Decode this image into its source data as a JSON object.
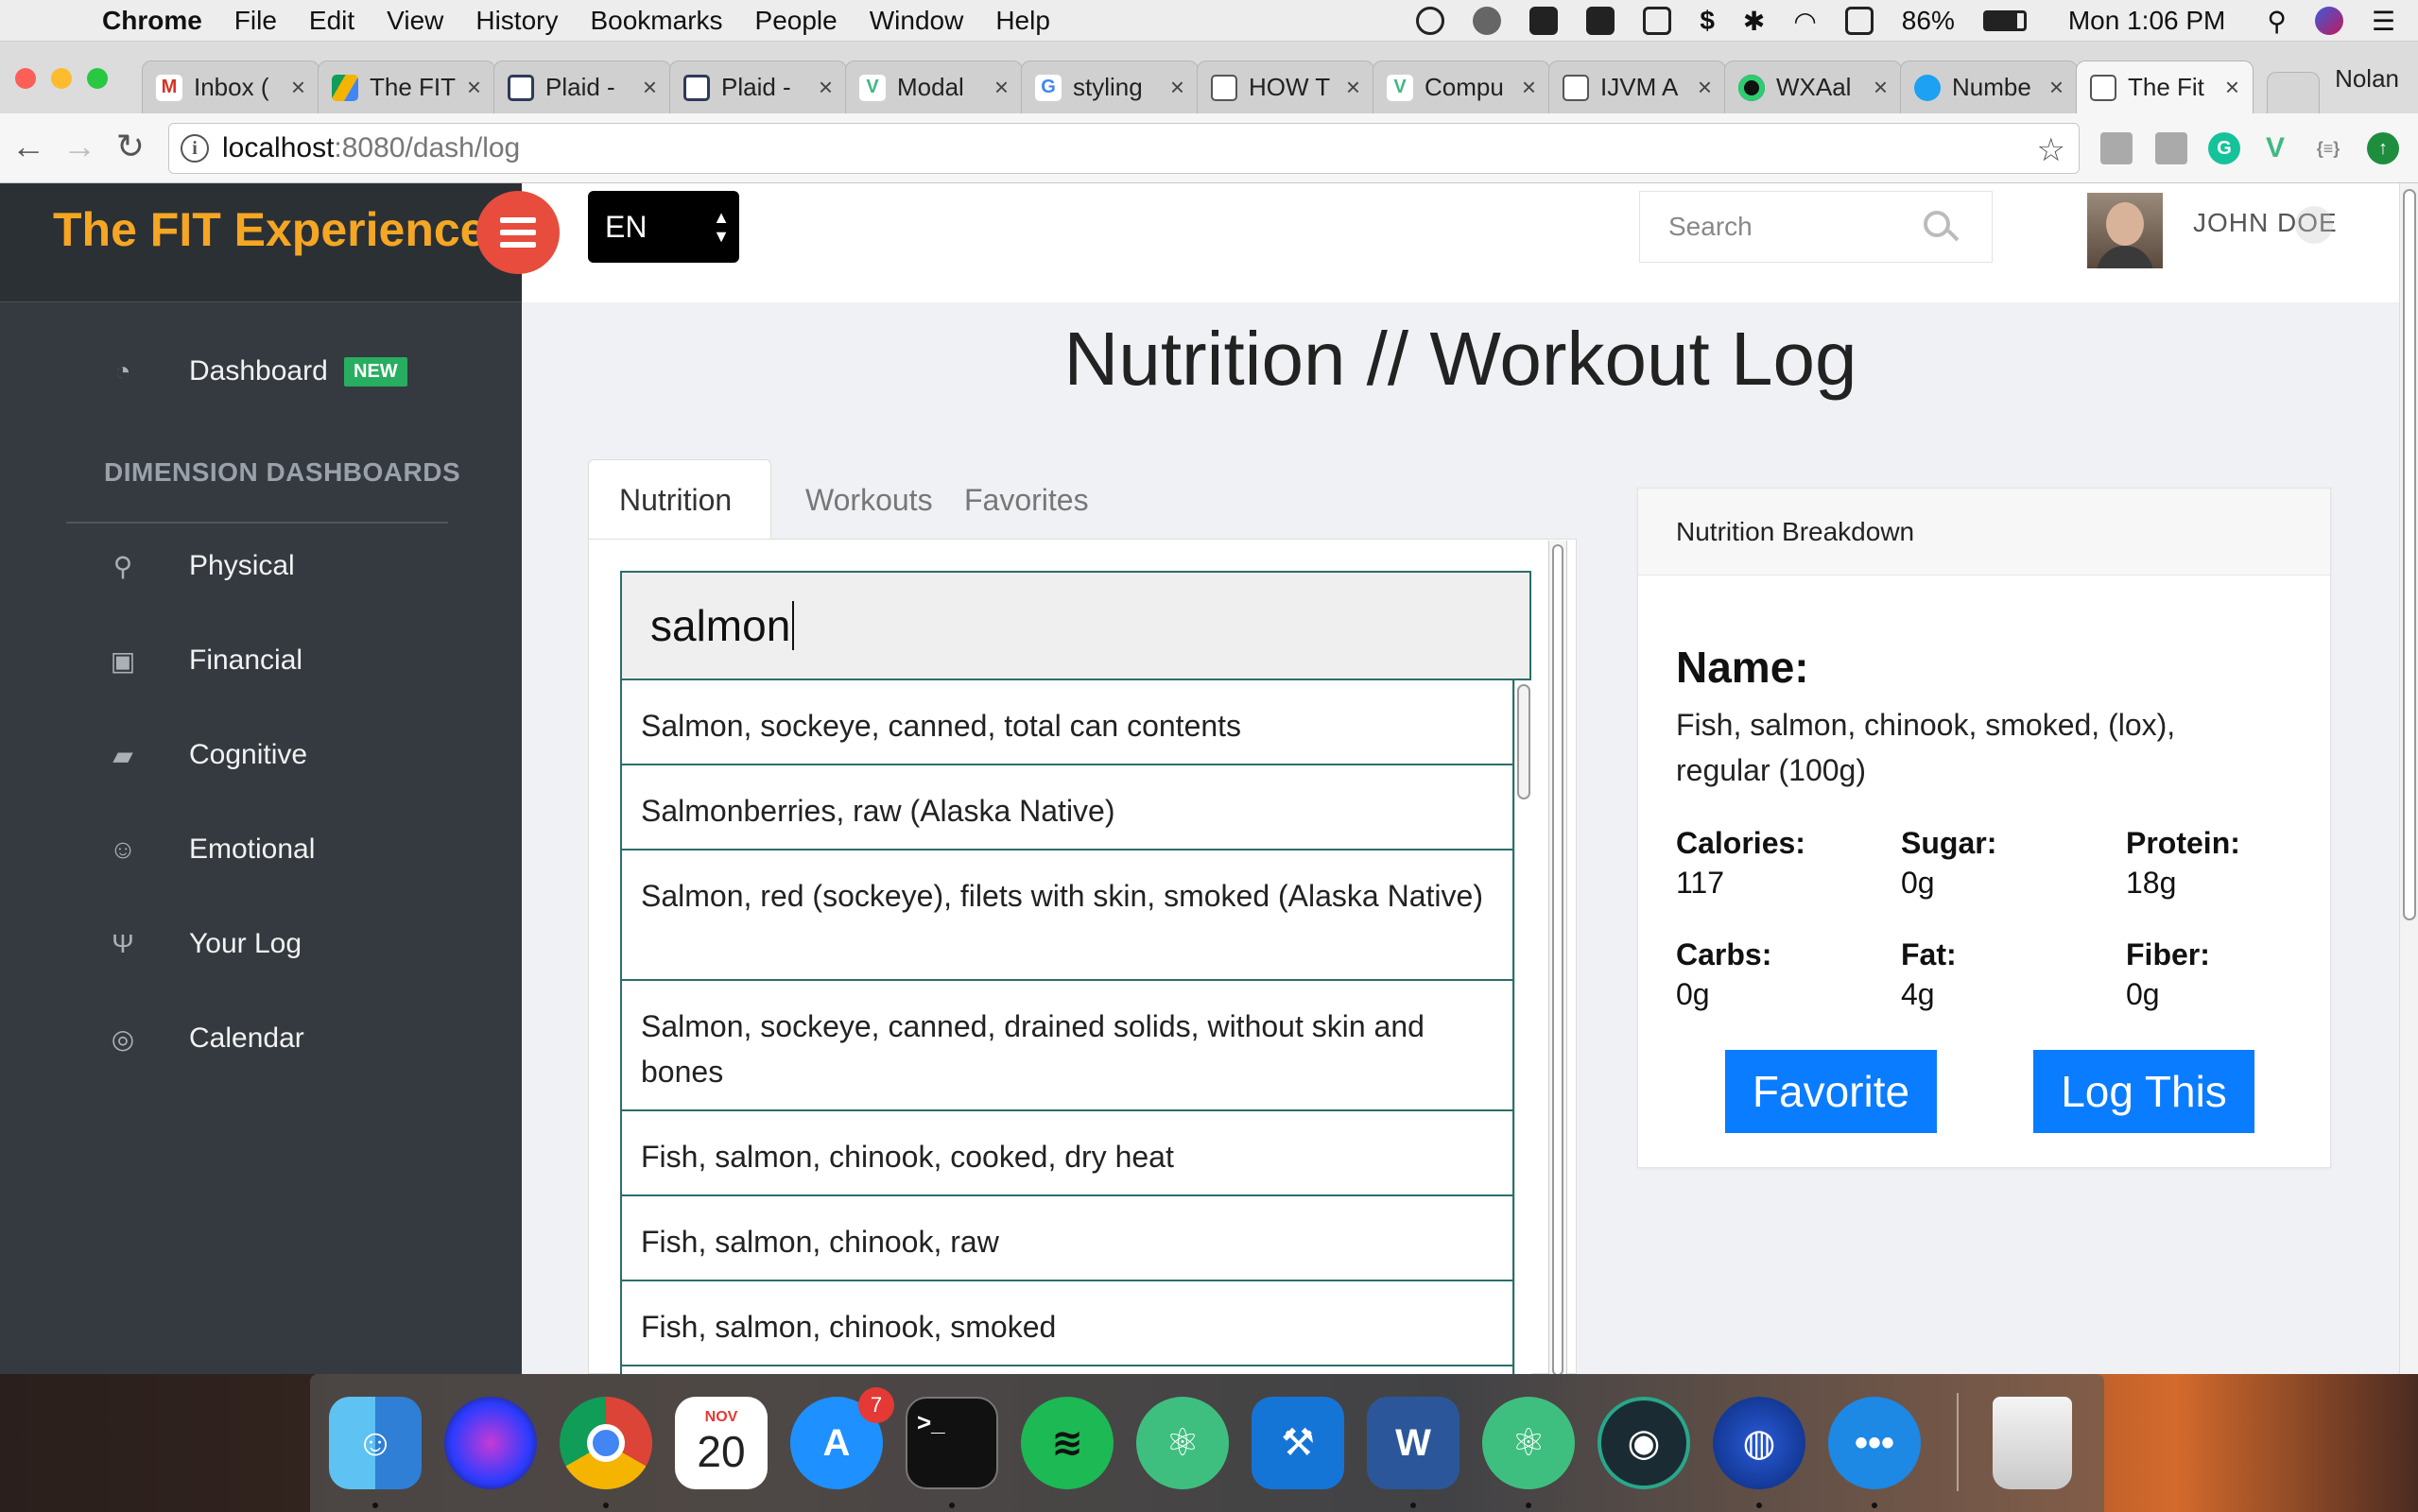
{
  "menubar": {
    "app": "Chrome",
    "items": [
      "File",
      "Edit",
      "View",
      "History",
      "Bookmarks",
      "People",
      "Window",
      "Help"
    ],
    "battery": "86%",
    "clock": "Mon 1:06 PM"
  },
  "tabs": [
    {
      "label": "Inbox (",
      "icon": "gmail-icon",
      "color": "#ffffff"
    },
    {
      "label": "The FIT",
      "icon": "drive-icon",
      "color": "#ffffff"
    },
    {
      "label": "Plaid -",
      "icon": "plaid-icon",
      "color": "#ffffff"
    },
    {
      "label": "Plaid -",
      "icon": "plaid-icon",
      "color": "#ffffff"
    },
    {
      "label": "Modal",
      "icon": "vue-icon",
      "color": "#ffffff"
    },
    {
      "label": "styling",
      "icon": "google-icon",
      "color": "#ffffff"
    },
    {
      "label": "HOW T",
      "icon": "document-icon",
      "color": "#ffffff"
    },
    {
      "label": "Compu",
      "icon": "vue-icon",
      "color": "#ffffff"
    },
    {
      "label": "IJVM A",
      "icon": "document-icon",
      "color": "#ffffff"
    },
    {
      "label": "WXAal",
      "icon": "app-icon",
      "color": "#ffffff"
    },
    {
      "label": "Numbe",
      "icon": "app-icon",
      "color": "#ffffff"
    },
    {
      "label": "The Fit",
      "icon": "document-icon",
      "color": "#ffffff"
    }
  ],
  "profile_name": "Nolan",
  "address": {
    "host": "localhost",
    "path": ":8080/dash/log"
  },
  "brand": {
    "title": "The FIT Experience",
    "accent": "#f5a623",
    "toggle_color": "#e74c3c"
  },
  "sidebar": {
    "dashboard": {
      "label": "Dashboard",
      "badge": "NEW"
    },
    "section_heading": "DIMENSION DASHBOARDS",
    "items": [
      {
        "label": "Physical",
        "icon": "bicycle-icon",
        "glyph": "⚲"
      },
      {
        "label": "Financial",
        "icon": "money-icon",
        "glyph": "▣"
      },
      {
        "label": "Cognitive",
        "icon": "book-icon",
        "glyph": "▰"
      },
      {
        "label": "Emotional",
        "icon": "smile-icon",
        "glyph": "☺"
      },
      {
        "label": "Your Log",
        "icon": "utensils-icon",
        "glyph": "Ψ"
      },
      {
        "label": "Calendar",
        "icon": "target-icon",
        "glyph": "◎"
      }
    ]
  },
  "header": {
    "language": "EN",
    "search_placeholder": "Search",
    "username": "JOHN DOE"
  },
  "main": {
    "title": "Nutrition // Workout Log",
    "tabs": [
      "Nutrition",
      "Workouts",
      "Favorites"
    ],
    "search_value": "salmon",
    "results": [
      "Salmon, sockeye, canned, total can contents",
      "Salmonberries, raw (Alaska Native)",
      "Salmon, red (sockeye), filets with skin, smoked (Alaska Native)",
      "Salmon, sockeye, canned, drained solids, without skin and bones",
      "Fish, salmon, chinook, cooked, dry heat",
      "Fish, salmon, chinook, raw",
      "Fish, salmon, chinook, smoked",
      ""
    ]
  },
  "breakdown": {
    "header": "Nutrition Breakdown",
    "name_label": "Name:",
    "name_value": "Fish, salmon, chinook, smoked, (lox), regular (100g)",
    "nutrients": [
      {
        "label": "Calories:",
        "value": "117"
      },
      {
        "label": "Sugar:",
        "value": "0g"
      },
      {
        "label": "Protein:",
        "value": "18g"
      },
      {
        "label": "Carbs:",
        "value": "0g"
      },
      {
        "label": "Fat:",
        "value": "4g"
      },
      {
        "label": "Fiber:",
        "value": "0g"
      }
    ],
    "favorite_label": "Favorite",
    "log_label": "Log This",
    "button_color": "#0a7cff"
  },
  "dock": {
    "calendar_month": "NOV",
    "calendar_day": "20",
    "appstore_badge": "7",
    "apps": [
      "finder-icon",
      "siri-icon",
      "chrome-icon",
      "calendar-icon",
      "app-store-icon",
      "terminal-icon",
      "spotify-icon",
      "atom-icon",
      "xcode-icon",
      "word-icon",
      "atom-icon",
      "gitkraken-icon",
      "firefox-icon",
      "messages-icon",
      "trash-icon"
    ]
  }
}
